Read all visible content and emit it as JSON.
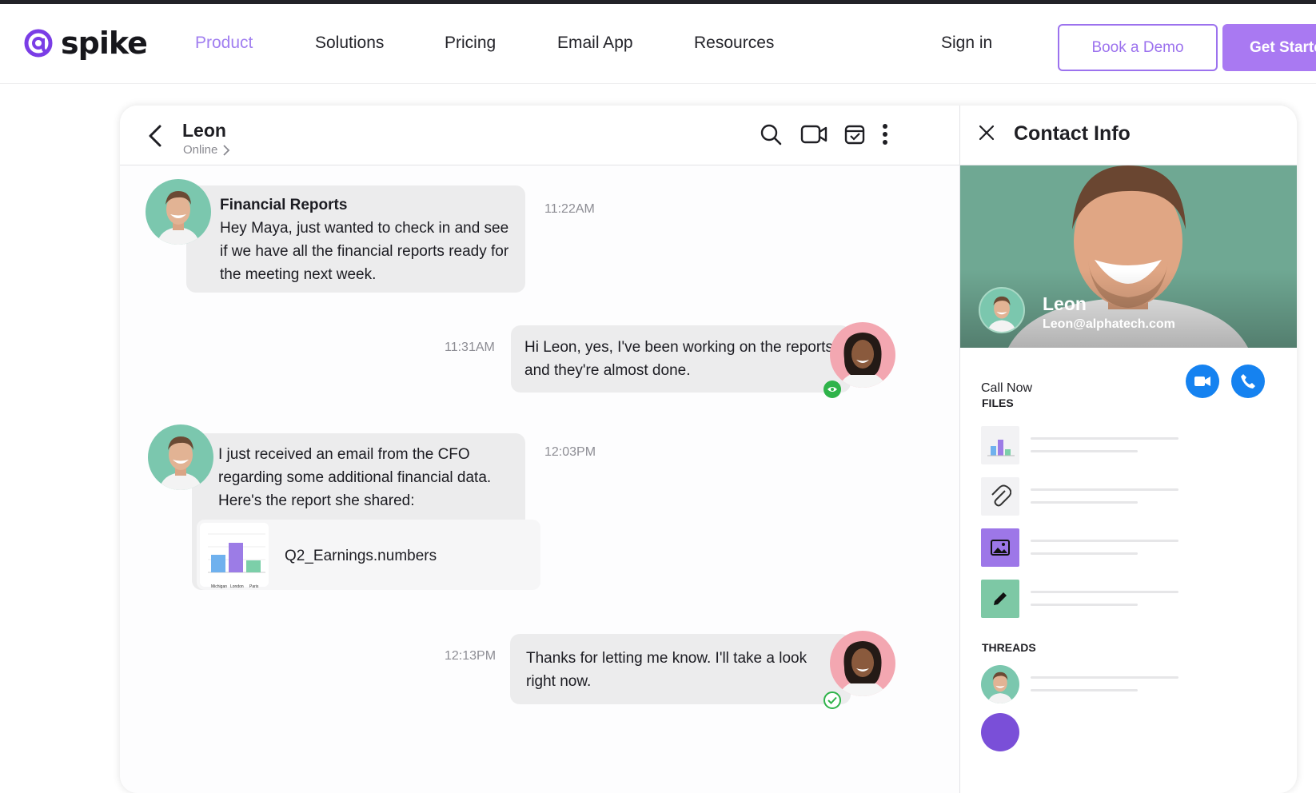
{
  "nav": {
    "brand": "spike",
    "items": [
      "Product",
      "Solutions",
      "Pricing",
      "Email App",
      "Resources"
    ],
    "active_item": "Product",
    "sign_in": "Sign in",
    "book_demo": "Book a Demo",
    "get_started": "Get Started",
    "accent_color": "#a979f2"
  },
  "chat": {
    "contact_name": "Leon",
    "contact_status": "Online",
    "header_icons": [
      "search-icon",
      "video-icon",
      "calendar-check-icon",
      "more-vertical-icon"
    ],
    "messages": [
      {
        "from": "Leon",
        "title": "Financial Reports",
        "text": "Hey Maya, just wanted to check in and see if we have all the financial reports ready for the meeting next week.",
        "time": "11:22AM"
      },
      {
        "from": "Maya",
        "text": "Hi Leon, yes, I've been working on the reports and they're almost done.",
        "time": "11:31AM",
        "receipt": "seen"
      },
      {
        "from": "Leon",
        "text": "I just received an email from the CFO regarding some additional financial data. Here's the report she shared:",
        "time": "12:03PM",
        "attachment": {
          "name": "Q2_Earnings.numbers",
          "thumb_labels": [
            "Michigan",
            "London",
            "Paris"
          ]
        }
      },
      {
        "from": "Maya",
        "text": "Thanks for letting me know. I'll take a look right now.",
        "time": "12:13PM",
        "receipt": "delivered"
      }
    ]
  },
  "contact_info": {
    "title": "Contact Info",
    "name": "Leon",
    "email": "Leon@alphatech.com",
    "call_now": "Call Now",
    "files_label": "FILES",
    "threads_label": "THREADS",
    "file_types": [
      "chart-file-icon",
      "paperclip-icon",
      "image-icon",
      "pencil-icon"
    ],
    "call_color": "#1582f0"
  }
}
